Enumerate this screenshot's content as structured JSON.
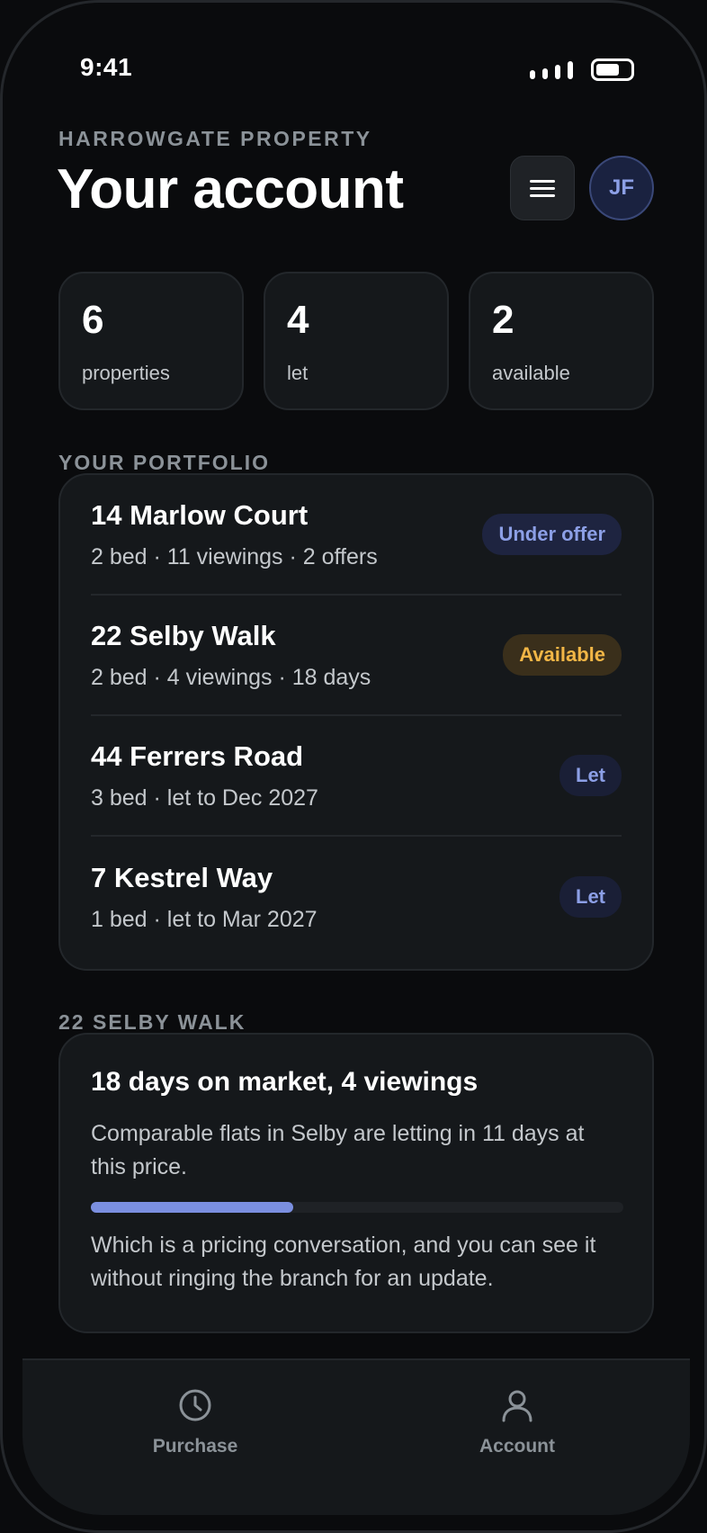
{
  "status_bar": {
    "time": "9:41"
  },
  "header": {
    "eyebrow": "HARROWGATE PROPERTY",
    "title": "Your account",
    "avatar_initials": "JF",
    "menu_icon": "hamburger-menu-icon"
  },
  "stats": [
    {
      "value": "6",
      "label": "properties"
    },
    {
      "value": "4",
      "label": "let"
    },
    {
      "value": "2",
      "label": "available"
    }
  ],
  "portfolio": {
    "label": "YOUR PORTFOLIO",
    "items": [
      {
        "name": "14 Marlow Court",
        "meta": "2 bed · 11 viewings · 2 offers",
        "status": "Under offer"
      },
      {
        "name": "22 Selby Walk",
        "meta": "2 bed · 4 viewings · 18 days",
        "status": "Available"
      },
      {
        "name": "44 Ferrers Road",
        "meta": "3 bed · let to Dec 2027",
        "status": "Let"
      },
      {
        "name": "7 Kestrel Way",
        "meta": "1 bed · let to Mar 2027",
        "status": "Let"
      }
    ]
  },
  "insight": {
    "label": "22 SELBY WALK",
    "title": "18 days on market, 4 viewings",
    "body": "Comparable flats in Selby are letting in 11 days at this price.",
    "progress": 0.38,
    "footer": "Which is a pricing conversation, and you can see it without ringing the branch for an update."
  },
  "tabbar": {
    "tabs": [
      {
        "label": "Purchase",
        "icon": "clock-icon"
      },
      {
        "label": "Account",
        "icon": "person-icon"
      }
    ]
  },
  "colors": {
    "background": "#0a0b0d",
    "card": "#15181b",
    "accent": "#7b8fe0",
    "available": "#f2b646"
  }
}
